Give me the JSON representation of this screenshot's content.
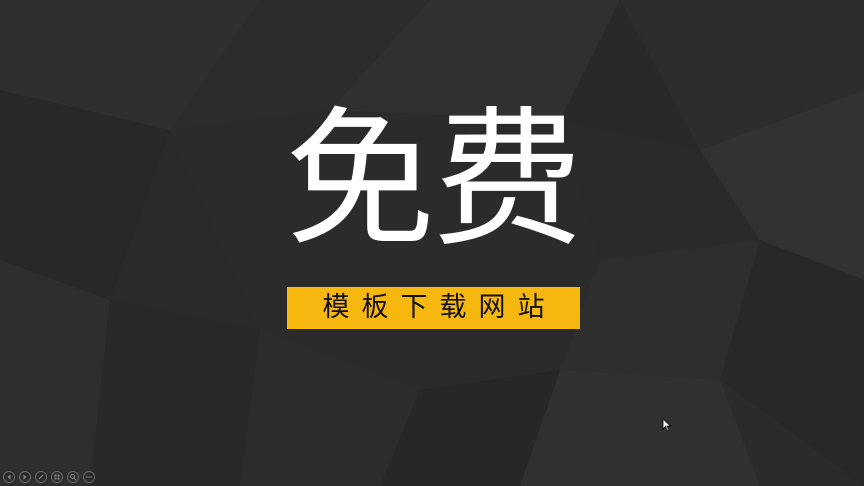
{
  "slide": {
    "headline": "免费",
    "subtitle": "模板下载网站",
    "accent_color": "#f6b70f",
    "background_color": "#2b2b2b"
  },
  "controls": [
    {
      "name": "previous-slide-button",
      "icon": "arrow-left-icon"
    },
    {
      "name": "next-slide-button",
      "icon": "arrow-right-icon"
    },
    {
      "name": "pen-tool-button",
      "icon": "pen-icon"
    },
    {
      "name": "see-all-slides-button",
      "icon": "slides-grid-icon"
    },
    {
      "name": "zoom-button",
      "icon": "magnifier-icon"
    },
    {
      "name": "more-options-button",
      "icon": "more-dots-icon"
    }
  ]
}
